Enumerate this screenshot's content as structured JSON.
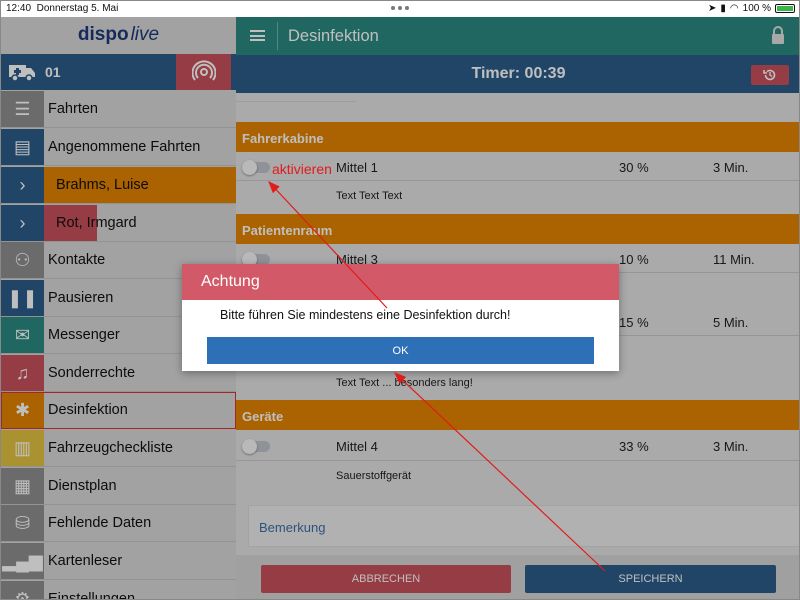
{
  "status": {
    "time": "12:40",
    "date": "Donnerstag 5. Mai",
    "battery": "100 %"
  },
  "sidebar": {
    "logo_a": "dispo",
    "logo_b": "live",
    "vehicle": "01",
    "items": [
      {
        "label": "Fahrten",
        "icon": "list-icon",
        "color": "#8f8f8f"
      },
      {
        "label": "Angenommene Fahrten",
        "icon": "id-card-icon",
        "color": "#2b5c8a"
      },
      {
        "label": "Brahms, Luise",
        "icon": "chevron-right-icon",
        "color": "#e38500"
      },
      {
        "label": "Rot, Irmgard",
        "icon": "chevron-right-icon",
        "color": "#c9505b"
      },
      {
        "label": "Kontakte",
        "icon": "users-icon",
        "color": "#8f8f8f"
      },
      {
        "label": "Pausieren",
        "icon": "pause-icon",
        "color": "#2b5c8a"
      },
      {
        "label": "Messenger",
        "icon": "envelope-icon",
        "color": "#2a8a80"
      },
      {
        "label": "Sonderrechte",
        "icon": "bell-icon",
        "color": "#c9505b"
      },
      {
        "label": "Desinfektion",
        "icon": "bug-icon",
        "color": "#e38500"
      },
      {
        "label": "Fahrzeugcheckliste",
        "icon": "book-icon",
        "color": "#e3c341"
      },
      {
        "label": "Dienstplan",
        "icon": "list-box-icon",
        "color": "#8f8f8f"
      },
      {
        "label": "Fehlende Daten",
        "icon": "database-icon",
        "color": "#8f8f8f"
      },
      {
        "label": "Kartenleser",
        "icon": "signal-icon",
        "color": "#8f8f8f"
      },
      {
        "label": "Einstellungen",
        "icon": "gear-icon",
        "color": "#8f8f8f"
      }
    ]
  },
  "header": {
    "title": "Desinfektion",
    "timer": "Timer: 00:39"
  },
  "sections": [
    {
      "title": "Fahrerkabine",
      "items": [
        {
          "name": "Mittel 1",
          "percent": "30 %",
          "duration": "3 Min.",
          "note": "Text Text Text"
        }
      ]
    },
    {
      "title": "Patientenraum",
      "items": [
        {
          "name": "Mittel 3",
          "percent": "10 %",
          "duration": "11 Min.",
          "note": ""
        },
        {
          "name": "",
          "percent": "15 %",
          "duration": "5 Min.",
          "note": "Text Text ... besonders lang!"
        }
      ]
    },
    {
      "title": "Geräte",
      "items": [
        {
          "name": "Mittel 4",
          "percent": "33 %",
          "duration": "3 Min.",
          "note": "Sauerstoffgerät"
        }
      ]
    }
  ],
  "remark_placeholder": "Bemerkung",
  "buttons": {
    "cancel": "ABBRECHEN",
    "save": "SPEICHERN"
  },
  "dialog": {
    "title": "Achtung",
    "message": "Bitte führen Sie mindestens eine Desinfektion durch!",
    "ok": "OK"
  },
  "annotation": {
    "label": "aktivieren",
    "color": "#e21b1b"
  }
}
